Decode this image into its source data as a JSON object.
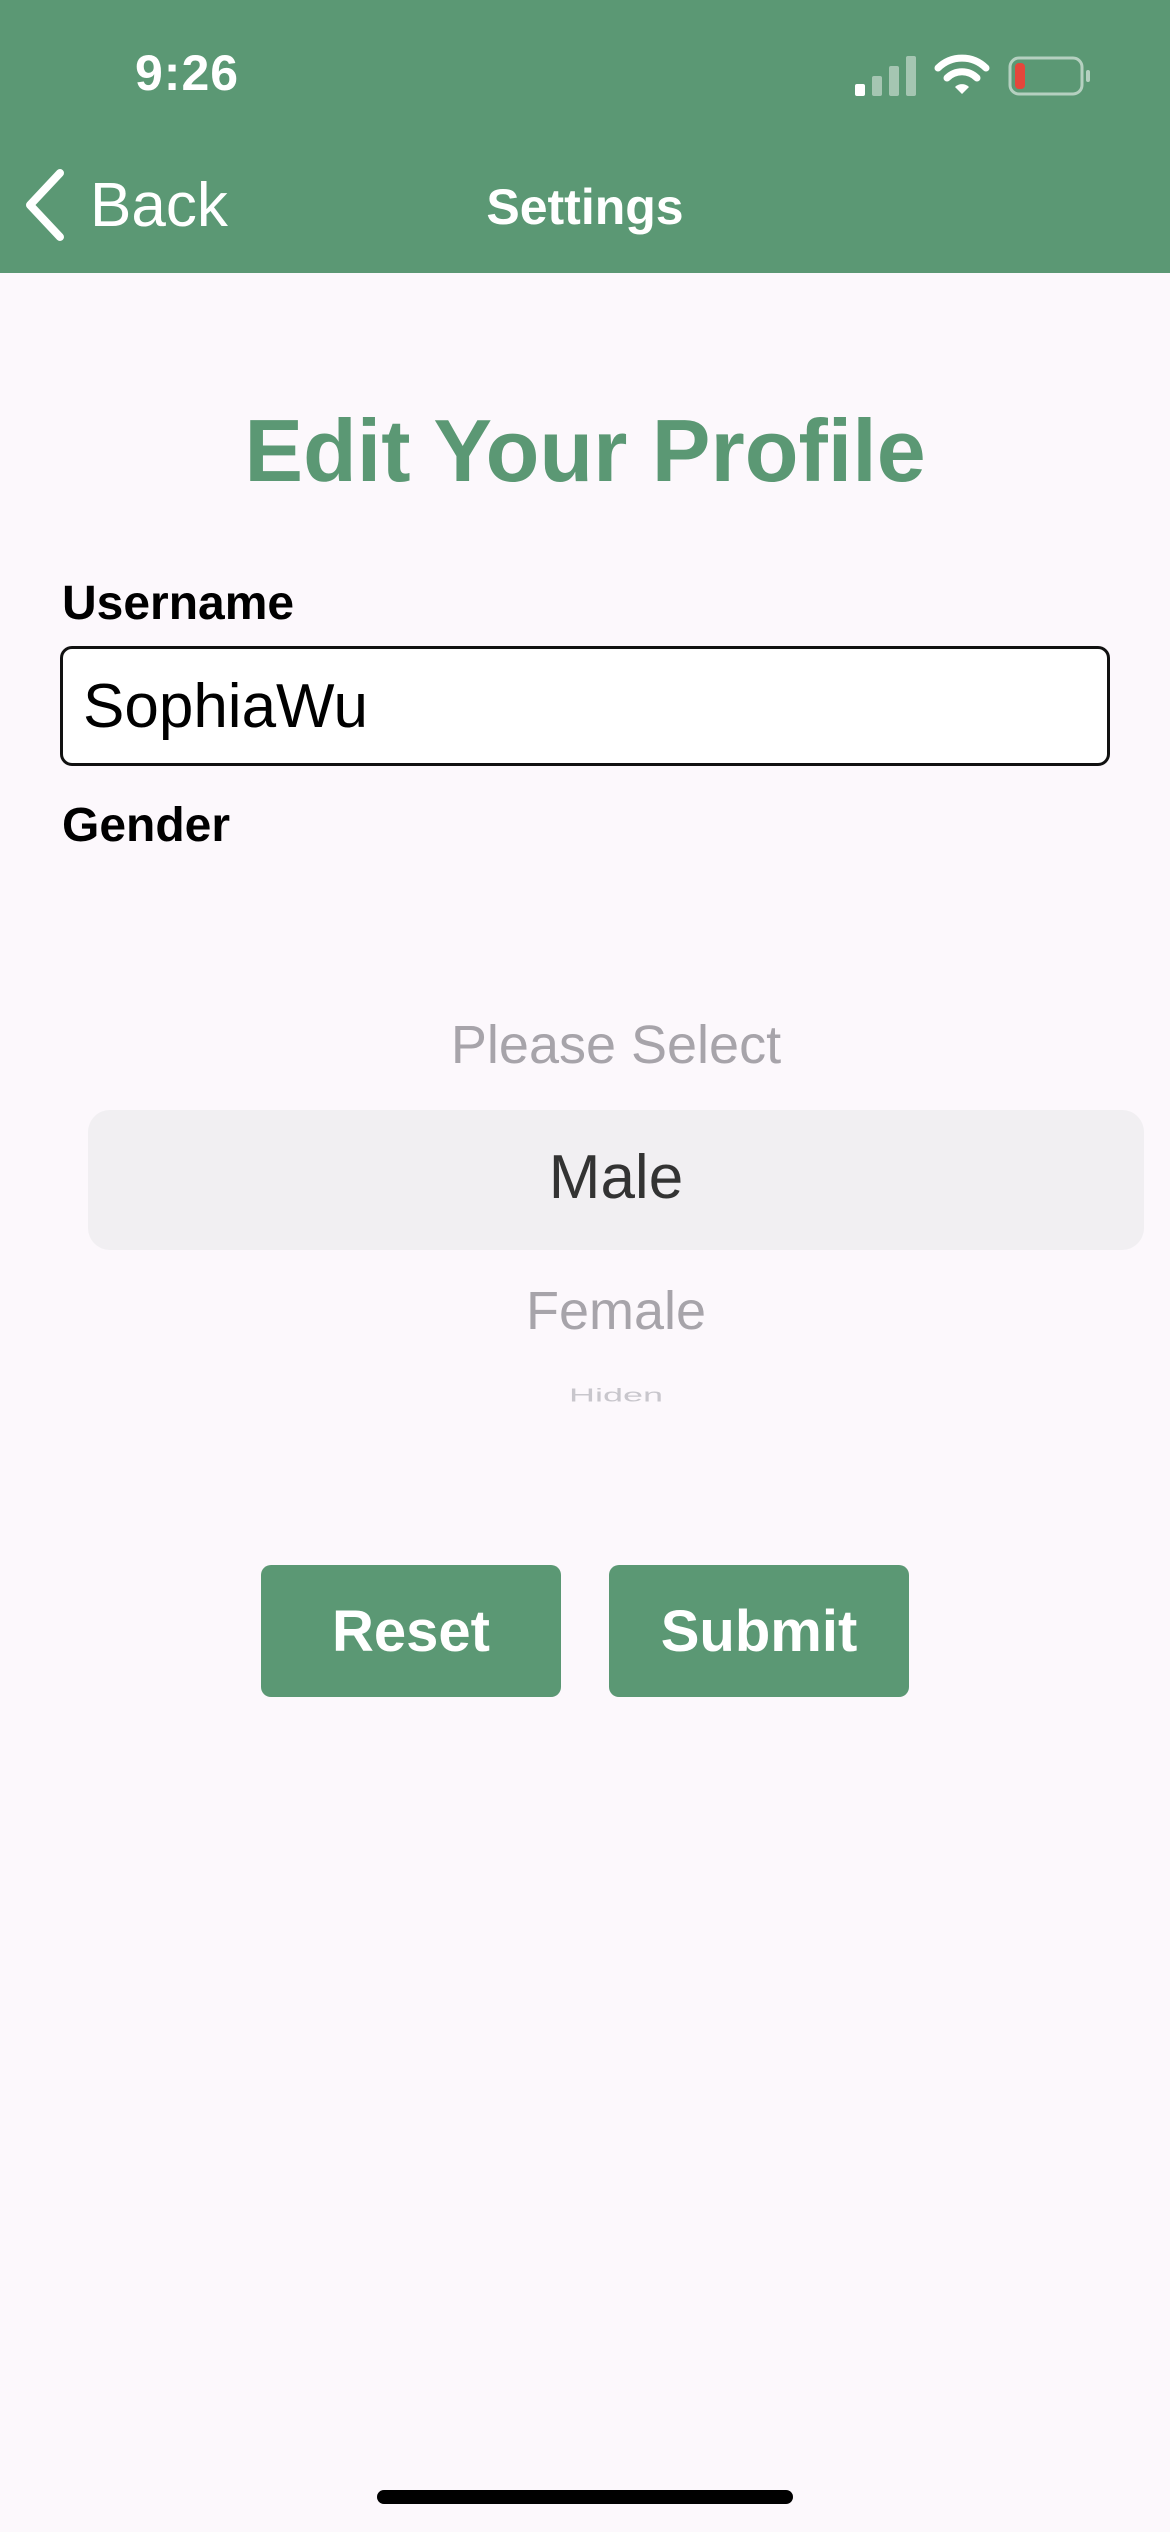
{
  "status_bar": {
    "time": "9:26",
    "battery_color": "#e5463b"
  },
  "nav": {
    "back_label": "Back",
    "title": "Settings"
  },
  "page": {
    "title": "Edit Your Profile"
  },
  "form": {
    "username_label": "Username",
    "username_value": "SophiaWu",
    "gender_label": "Gender",
    "gender_options": [
      "Please Select",
      "Male",
      "Female",
      "Hiden"
    ],
    "gender_selected": "Male"
  },
  "buttons": {
    "reset_label": "Reset",
    "submit_label": "Submit"
  },
  "colors": {
    "accent": "#5b9874",
    "background": "#fcf8fc"
  },
  "icons": {
    "signal": "signal-bars-icon",
    "wifi": "wifi-icon",
    "battery": "battery-low-icon",
    "back": "chevron-left-icon"
  }
}
